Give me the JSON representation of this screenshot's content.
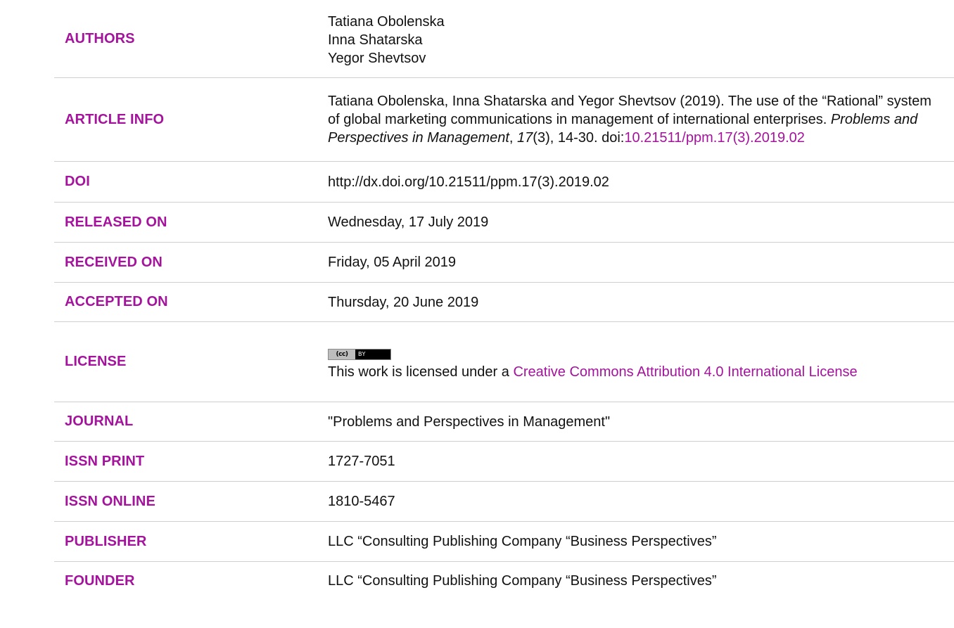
{
  "rows": {
    "authors": {
      "label": "AUTHORS",
      "names": [
        "Tatiana Obolenska",
        "Inna Shatarska",
        "Yegor Shevtsov"
      ]
    },
    "article_info": {
      "label": "ARTICLE INFO",
      "citation_prefix": "Tatiana Obolenska, Inna Shatarska and Yegor Shevtsov (2019). The use of the “Rational” system of global marketing communications in management of international enterprises. ",
      "journal_italic": "Problems and Perspectives in Management",
      "comma1": ", ",
      "volume_italic": "17",
      "issue_pages": "(3), 14-30. doi:",
      "doi_link": "10.21511/ppm.17(3).2019.02"
    },
    "doi": {
      "label": "DOI",
      "value": "http://dx.doi.org/10.21511/ppm.17(3).2019.02"
    },
    "released_on": {
      "label": "RELEASED ON",
      "value": "Wednesday, 17 July 2019"
    },
    "received_on": {
      "label": "RECEIVED ON",
      "value": "Friday, 05 April 2019"
    },
    "accepted_on": {
      "label": "ACCEPTED ON",
      "value": "Thursday, 20 June 2019"
    },
    "license": {
      "label": "LICENSE",
      "badge_left": "(cc)",
      "badge_right": "BY",
      "text_prefix": "This work is licensed under a ",
      "link_text": "Creative Commons Attribution 4.0 International License"
    },
    "journal": {
      "label": "JOURNAL",
      "value": "\"Problems and Perspectives in Management\""
    },
    "issn_print": {
      "label": "ISSN PRINT",
      "value": "1727-7051"
    },
    "issn_online": {
      "label": "ISSN ONLINE",
      "value": "1810-5467"
    },
    "publisher": {
      "label": "PUBLISHER",
      "value": "LLC “Consulting Publishing Company “Business Perspectives”"
    },
    "founder": {
      "label": "FOUNDER",
      "value": "LLC “Consulting Publishing Company “Business Perspectives”"
    }
  },
  "colors": {
    "accent": "#a4139c",
    "text": "#111111",
    "divider": "#cfcfcf"
  }
}
